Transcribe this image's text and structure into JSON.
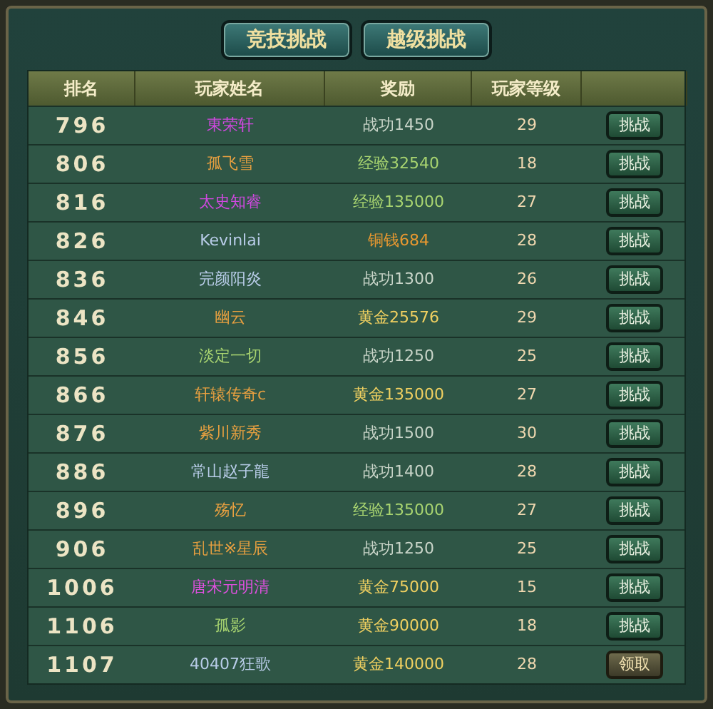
{
  "tabs": [
    {
      "label": "竞技挑战"
    },
    {
      "label": "越级挑战"
    }
  ],
  "table": {
    "columns": [
      "排名",
      "玩家姓名",
      "奖励",
      "玩家等级",
      ""
    ],
    "rows": [
      {
        "rank": "796",
        "name": {
          "text": "東荣轩",
          "color": "#d048e0"
        },
        "reward": {
          "text": "战功1450",
          "color": "#c8d4c8"
        },
        "level": "29",
        "action": {
          "kind": "challenge",
          "label": "挑战"
        }
      },
      {
        "rank": "806",
        "name": {
          "text": "孤飞雪",
          "color": "#e8a040"
        },
        "reward": {
          "text": "经验32540",
          "color": "#a8d470"
        },
        "level": "18",
        "action": {
          "kind": "challenge",
          "label": "挑战"
        }
      },
      {
        "rank": "816",
        "name": {
          "text": "太史知睿",
          "color": "#d048e0"
        },
        "reward": {
          "text": "经验135000",
          "color": "#a8d470"
        },
        "level": "27",
        "action": {
          "kind": "challenge",
          "label": "挑战"
        }
      },
      {
        "rank": "826",
        "name": {
          "text": "Kevinlai",
          "color": "#b8cce8"
        },
        "reward": {
          "text": "铜钱684",
          "color": "#e89830"
        },
        "level": "28",
        "action": {
          "kind": "challenge",
          "label": "挑战"
        }
      },
      {
        "rank": "836",
        "name": {
          "text": "完颜阳炎",
          "color": "#b8cce8"
        },
        "reward": {
          "text": "战功1300",
          "color": "#c8d4c8"
        },
        "level": "26",
        "action": {
          "kind": "challenge",
          "label": "挑战"
        }
      },
      {
        "rank": "846",
        "name": {
          "text": "幽云",
          "color": "#e8a040"
        },
        "reward": {
          "text": "黄金25576",
          "color": "#f0d060"
        },
        "level": "29",
        "action": {
          "kind": "challenge",
          "label": "挑战"
        }
      },
      {
        "rank": "856",
        "name": {
          "text": "淡定一切",
          "color": "#a8d470"
        },
        "reward": {
          "text": "战功1250",
          "color": "#c8d4c8"
        },
        "level": "25",
        "action": {
          "kind": "challenge",
          "label": "挑战"
        }
      },
      {
        "rank": "866",
        "name": {
          "text": "轩辕传奇c",
          "color": "#e8a040"
        },
        "reward": {
          "text": "黄金135000",
          "color": "#f0d060"
        },
        "level": "27",
        "action": {
          "kind": "challenge",
          "label": "挑战"
        }
      },
      {
        "rank": "876",
        "name": {
          "text": "紫川新秀",
          "color": "#e8a040"
        },
        "reward": {
          "text": "战功1500",
          "color": "#c8d4c8"
        },
        "level": "30",
        "action": {
          "kind": "challenge",
          "label": "挑战"
        }
      },
      {
        "rank": "886",
        "name": {
          "text": "常山赵子龍",
          "color": "#b8cce8"
        },
        "reward": {
          "text": "战功1400",
          "color": "#c8d4c8"
        },
        "level": "28",
        "action": {
          "kind": "challenge",
          "label": "挑战"
        }
      },
      {
        "rank": "896",
        "name": {
          "text": "殇忆",
          "color": "#e8a040"
        },
        "reward": {
          "text": "经验135000",
          "color": "#a8d470"
        },
        "level": "27",
        "action": {
          "kind": "challenge",
          "label": "挑战"
        }
      },
      {
        "rank": "906",
        "name": {
          "text": "乱世※星辰",
          "color": "#e8a040"
        },
        "reward": {
          "text": "战功1250",
          "color": "#c8d4c8"
        },
        "level": "25",
        "action": {
          "kind": "challenge",
          "label": "挑战"
        }
      },
      {
        "rank": "1006",
        "name": {
          "text": "唐宋元明清",
          "color": "#e050e0"
        },
        "reward": {
          "text": "黄金75000",
          "color": "#f0d060"
        },
        "level": "15",
        "action": {
          "kind": "challenge",
          "label": "挑战"
        }
      },
      {
        "rank": "1106",
        "name": {
          "text": "孤影",
          "color": "#a8d470"
        },
        "reward": {
          "text": "黄金90000",
          "color": "#f0d060"
        },
        "level": "18",
        "action": {
          "kind": "challenge",
          "label": "挑战"
        }
      },
      {
        "rank": "1107",
        "name": {
          "text": "40407狂歌",
          "color": "#b8cce8"
        },
        "reward": {
          "text": "黄金140000",
          "color": "#f0d060"
        },
        "level": "28",
        "action": {
          "kind": "claim",
          "label": "领取"
        }
      }
    ]
  }
}
